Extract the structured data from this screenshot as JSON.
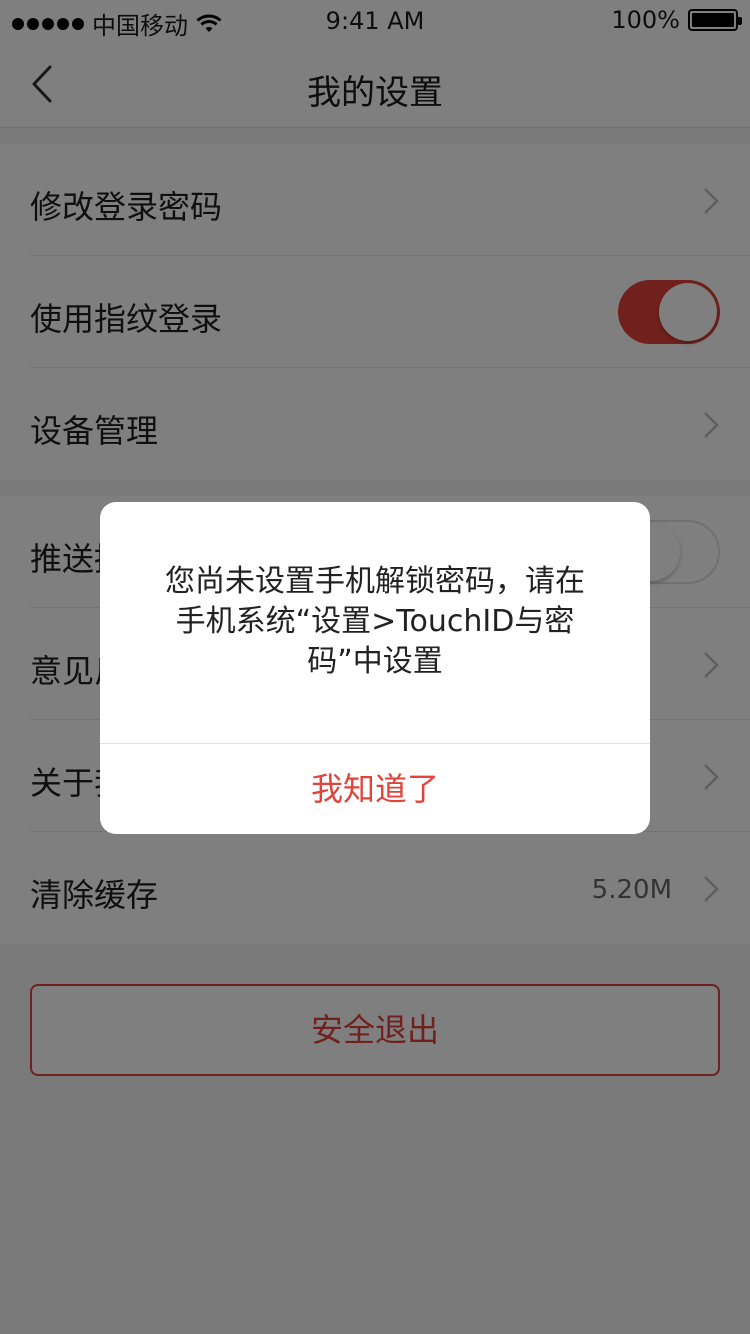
{
  "status_bar": {
    "carrier": "中国移动",
    "time": "9:41 AM",
    "battery": "100%"
  },
  "nav": {
    "title": "我的设置"
  },
  "settings": {
    "group1": [
      {
        "label": "修改登录密码",
        "type": "link"
      },
      {
        "label": "使用指纹登录",
        "type": "toggle",
        "state": "on"
      },
      {
        "label": "设备管理",
        "type": "link"
      }
    ],
    "group2": [
      {
        "label": "推送提醒",
        "type": "toggle",
        "state": "off"
      },
      {
        "label": "意见反馈",
        "type": "link"
      },
      {
        "label": "关于我们",
        "type": "link"
      },
      {
        "label": "清除缓存",
        "type": "link",
        "value": "5.20M"
      }
    ]
  },
  "logout_label": "安全退出",
  "dialog": {
    "message_line1": "您尚未设置手机解锁密码，请在",
    "message_line2": "手机系统“设置>TouchID与密",
    "message_line3": "码”中设置",
    "button_label": "我知道了"
  },
  "colors": {
    "accent": "#e2433a"
  }
}
